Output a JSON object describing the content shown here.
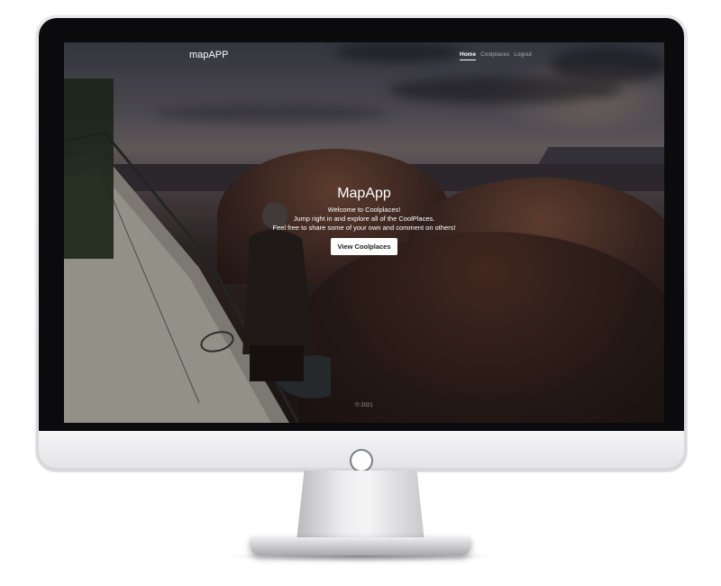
{
  "navbar": {
    "brand": "mapAPP",
    "links": [
      {
        "label": "Home",
        "active": true
      },
      {
        "label": "Coolplaces",
        "active": false
      },
      {
        "label": "Logout",
        "active": false
      }
    ]
  },
  "hero": {
    "title": "MapApp",
    "lines": [
      "Welcome to Coolplaces!",
      "Jump right in and explore all of the CoolPlaces.",
      "Feel free to share some of your own and comment on others!"
    ],
    "button_label": "View Coolplaces"
  },
  "footer": {
    "text": "© 2021"
  },
  "colors": {
    "nav_active": "#ffffff",
    "nav_inactive": "#a8a6a6",
    "button_bg": "#ffffff",
    "button_text": "#222222"
  }
}
